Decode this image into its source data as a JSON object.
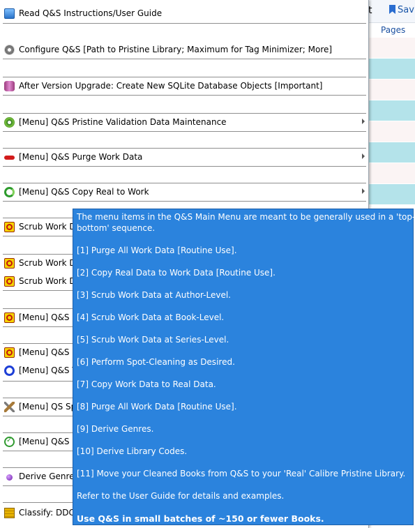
{
  "background_app": {
    "toolbar_partial_text": "t",
    "save_label": "Sav",
    "pages_header": "Pages"
  },
  "menu": {
    "items": [
      {
        "label": "Read Q&S Instructions/User Guide",
        "icon": "book-help-icon"
      },
      {
        "label": "Configure Q&S [Path to Pristine Library; Maximum for Tag Minimizer; More]",
        "icon": "gear-icon"
      },
      {
        "label": "After Version Upgrade: Create New SQLite Database Objects [Important]",
        "icon": "database-icon"
      },
      {
        "label": "[Menu] Q&S Pristine Validation Data Maintenance",
        "icon": "eye-icon",
        "submenu": true
      },
      {
        "label": "[Menu] Q&S Purge Work Data",
        "icon": "minus-icon",
        "submenu": true
      },
      {
        "label": "[Menu] Q&S Copy Real to Work",
        "icon": "recycle-icon",
        "submenu": true
      },
      {
        "label": "Scrub Work D",
        "icon": "biohazard-icon"
      },
      {
        "label": "Scrub Work D",
        "icon": "biohazard-icon"
      },
      {
        "label": "Scrub Work D",
        "icon": "biohazard-icon"
      },
      {
        "label": "[Menu] Q&S S",
        "icon": "biohazard-icon"
      },
      {
        "label": "[Menu] Q&S S",
        "icon": "biohazard-icon"
      },
      {
        "label": "[Menu] Q&S T",
        "icon": "blue-ring-icon"
      },
      {
        "label": "[Menu] QS Sp",
        "icon": "tools-icon"
      },
      {
        "label": "[Menu] Q&S G",
        "icon": "check-circle-icon"
      },
      {
        "label": "Derive Genres",
        "icon": "purple-dot-icon"
      },
      {
        "label": "Classify: DDC",
        "icon": "ledger-icon"
      }
    ]
  },
  "tooltip": {
    "intro_line1": "The menu items in the Q&S Main Menu are meant to be generally used in a 'top-to-",
    "intro_line2": "bottom' sequence.",
    "steps": [
      "[1] Purge All Work Data [Routine Use].",
      "[2] Copy Real Data to Work Data [Routine Use].",
      "[3] Scrub Work Data at Author-Level.",
      "[4] Scrub Work Data at Book-Level.",
      "[5] Scrub Work Data at Series-Level.",
      "[6] Perform Spot-Cleaning as Desired.",
      "[7] Copy Work Data to Real Data.",
      "[8] Purge All Work Data [Routine Use].",
      "[9] Derive Genres.",
      "[10] Derive Library Codes.",
      "[11] Move your Cleaned Books from Q&S to your 'Real' Calibre Pristine Library."
    ],
    "refer": "Refer to the User Guide for details and examples.",
    "warning": "Use Q&S in small batches of ~150 or fewer Books."
  }
}
